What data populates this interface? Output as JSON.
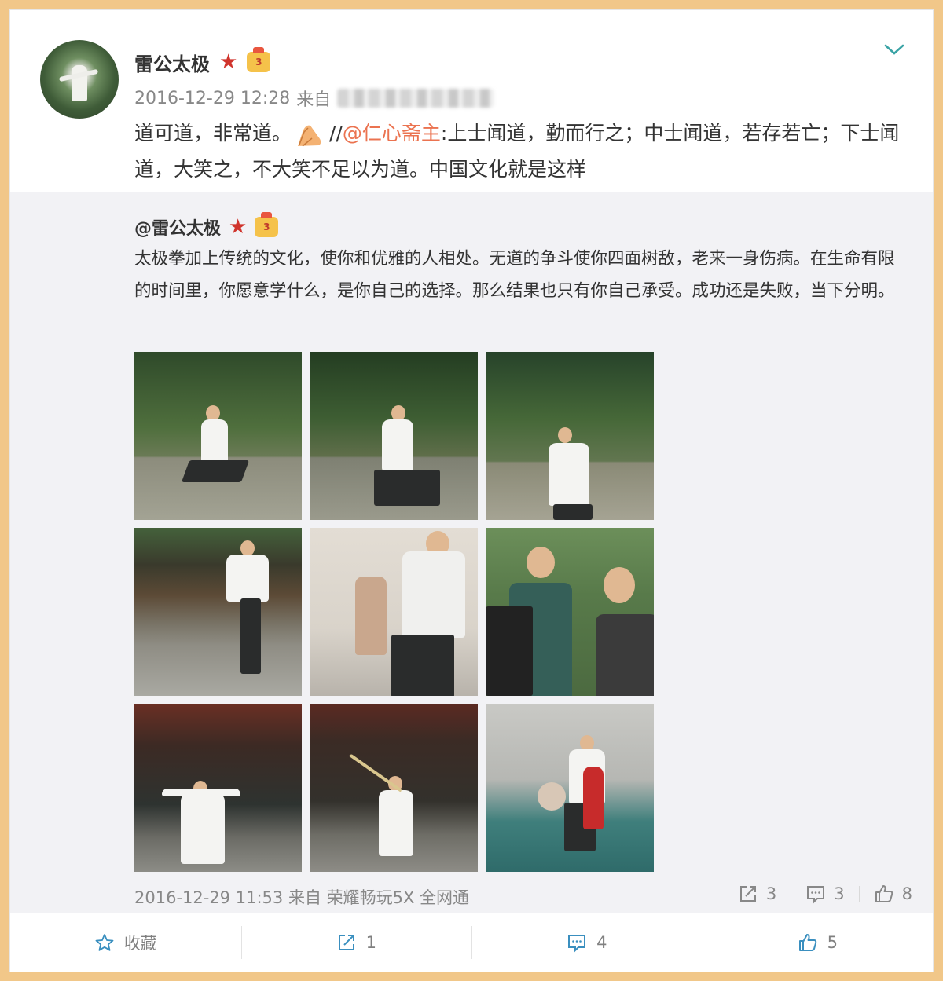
{
  "post": {
    "user_name": "雷公太极",
    "verified_icon": "red-star-icon",
    "vip_icon": "crown-badge-icon",
    "vip_level": "3",
    "timestamp": "2016-12-29 12:28",
    "source_prefix": "来自",
    "text_before": "道可道，非常道。",
    "emoji": "praying-hands-emoji",
    "text_separator": "//",
    "mention": "@仁心斋主",
    "text_after": ":上士闻道，勤而行之；中士闻道，若存若亡；下士闻道，大笑之，不大笑不足以为道。中国文化就是这样"
  },
  "repost": {
    "user_handle": "@雷公太极",
    "vip_level": "3",
    "text": "太极拳加上传统的文化，使你和优雅的人相处。无道的争斗使你四面树敌，老来一身伤病。在生命有限的时间里，你愿意学什么，是你自己的选择。那么结果也只有你自己承受。成功还是失败，当下分明。",
    "timestamp": "2016-12-29 11:53",
    "source_prefix": "来自",
    "source": "荣耀畅玩5X 全网通",
    "repost_count": "3",
    "comment_count": "3",
    "like_count": "8",
    "photos": [
      {
        "name": "photo-garden-stance-1"
      },
      {
        "name": "photo-garden-stance-2"
      },
      {
        "name": "photo-garden-stance-3"
      },
      {
        "name": "photo-demo-audience"
      },
      {
        "name": "photo-teaching-child"
      },
      {
        "name": "photo-push-hands"
      },
      {
        "name": "photo-pavilion-stance"
      },
      {
        "name": "photo-pavilion-sword"
      },
      {
        "name": "photo-gym-fan"
      }
    ]
  },
  "actions": {
    "favorite_label": "收藏",
    "repost_count": "1",
    "comment_count": "4",
    "like_count": "5"
  },
  "colors": {
    "background": "#f1c789",
    "mention": "#eb7350",
    "accent": "#3aa3a5",
    "repost_bg": "#f2f2f5"
  }
}
